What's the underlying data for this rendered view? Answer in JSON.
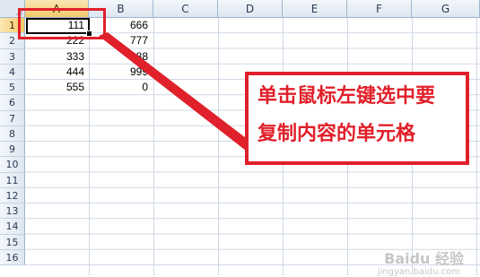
{
  "columns": [
    "A",
    "B",
    "C",
    "D",
    "E",
    "F",
    "G"
  ],
  "rows": [
    "1",
    "2",
    "3",
    "4",
    "5",
    "6",
    "7",
    "8",
    "9",
    "10",
    "11",
    "12",
    "13",
    "14",
    "15",
    "16"
  ],
  "cells": {
    "A1": "111",
    "B1": "666",
    "A2": "222",
    "B2": "777",
    "A3": "333",
    "B3": "888",
    "A4": "444",
    "B4": "999",
    "A5": "555",
    "B5": "0"
  },
  "selected_cell": "A1",
  "annotation": {
    "line1": "单击鼠标左键选中要",
    "line2": "复制内容的单元格",
    "color": "#e0202a"
  },
  "watermark": {
    "text": "Baidu 经验",
    "sub": "jingyan.baidu.com"
  }
}
